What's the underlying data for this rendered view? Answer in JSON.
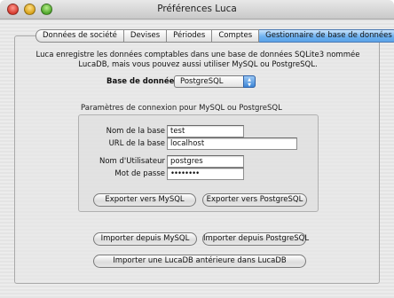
{
  "window": {
    "title": "Préférences Luca"
  },
  "tabs": [
    {
      "label": "Données de société",
      "selected": false
    },
    {
      "label": "Devises",
      "selected": false
    },
    {
      "label": "Périodes",
      "selected": false
    },
    {
      "label": "Comptes",
      "selected": false
    },
    {
      "label": "Gestionnaire de base de données",
      "selected": true
    }
  ],
  "main": {
    "description": "Luca enregistre les données comptables dans une base de données SQLite3 nommée LucaDB, mais vous pouvez aussi utiliser MySQL ou PostgreSQL.",
    "database_label": "Base de données",
    "database_value": "PostgreSQL",
    "connection_group_title": "Paramètres de connexion pour MySQL ou PostgreSQL",
    "fields": {
      "db_name_label": "Nom de la base",
      "db_name_value": "test",
      "db_url_label": "URL de la base",
      "db_url_value": "localhost",
      "user_label": "Nom d'Utilisateur",
      "user_value": "postgres",
      "password_label": "Mot de passe",
      "password_value": "••••••••"
    },
    "buttons": {
      "export_mysql": "Exporter vers MySQL",
      "export_postgresql": "Exporter vers PostgreSQL",
      "import_mysql": "Importer depuis MySQL",
      "import_postgresql": "Importer depuis PostgreSQL",
      "import_lucadb": "Importer une LucaDB antérieure dans LucaDB"
    }
  },
  "colors": {
    "selected_tab": "#6fb2f0",
    "close_button": "#d63b2f",
    "minimize_button": "#d8a218",
    "zoom_button": "#4fa62b"
  }
}
